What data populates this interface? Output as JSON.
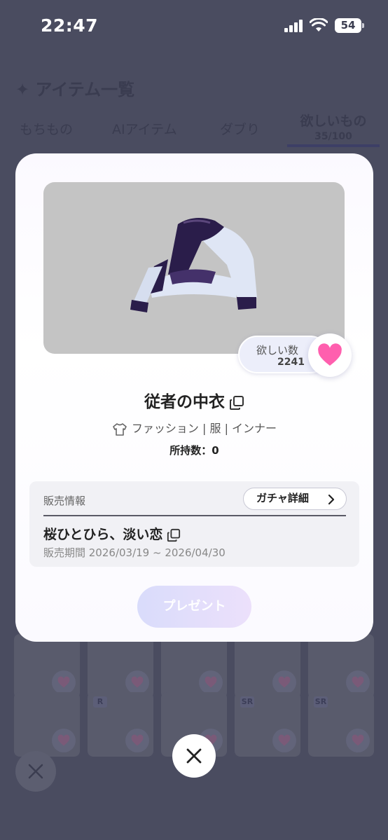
{
  "status_bar": {
    "time": "22:47",
    "battery": "54"
  },
  "background": {
    "title": "✦ アイテム一覧",
    "tabs": [
      {
        "label": "もちもの"
      },
      {
        "label": "AIアイテム"
      },
      {
        "label": "ダブり"
      },
      {
        "label": "欲しいもの",
        "count": "35/100"
      }
    ],
    "grid_tags": [
      "R",
      "SR",
      "SR"
    ]
  },
  "modal": {
    "wish": {
      "label": "欲しい数",
      "count": "2241"
    },
    "item_name": "従者の中衣",
    "category": "ファッション | 服 | インナー",
    "owned": "所持数：0",
    "sale": {
      "label": "販売情報",
      "detail_button": "ガチャ詳細",
      "gacha_name": "桜ひとひら、淡い恋",
      "period": "販売期間 2026/03/19 ~ 2026/04/30"
    },
    "present_button": "プレゼント"
  },
  "colors": {
    "heart": "#ff5fae",
    "accent": "#3d3f66",
    "backdrop": "#4a4c60"
  }
}
